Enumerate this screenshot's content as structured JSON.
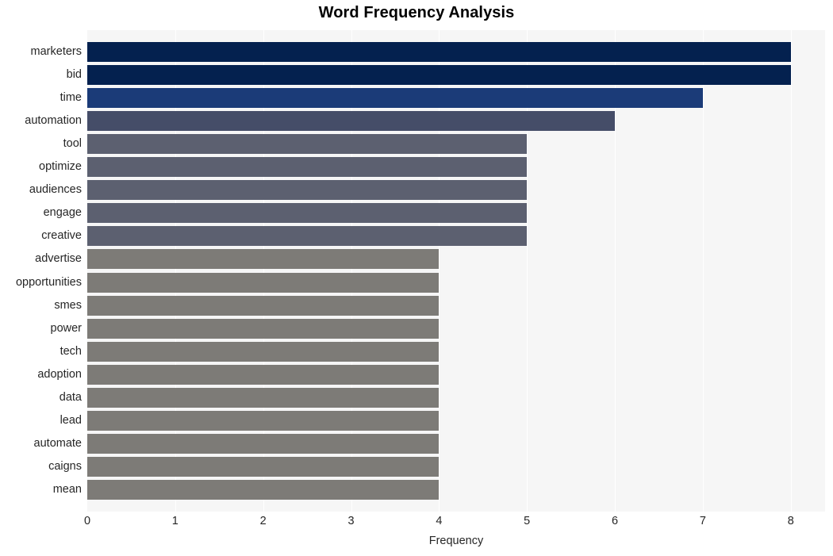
{
  "chart_data": {
    "type": "bar",
    "orientation": "horizontal",
    "title": "Word Frequency Analysis",
    "xlabel": "Frequency",
    "ylabel": "",
    "xlim": [
      0,
      8.39
    ],
    "xticks": [
      0,
      1,
      2,
      3,
      4,
      5,
      6,
      7,
      8
    ],
    "xtick_labels": [
      "0",
      "1",
      "2",
      "3",
      "4",
      "5",
      "6",
      "7",
      "8"
    ],
    "grid": true,
    "grid_axis": "x",
    "grid_color": "#ffffff",
    "plot_background": "#f6f6f6",
    "figure_background": "#ffffff",
    "legend": null,
    "categories": [
      "marketers",
      "bid",
      "time",
      "automation",
      "tool",
      "optimize",
      "audiences",
      "engage",
      "creative",
      "advertise",
      "opportunities",
      "smes",
      "power",
      "tech",
      "adoption",
      "data",
      "lead",
      "automate",
      "caigns",
      "mean"
    ],
    "values": [
      8,
      8,
      7,
      6,
      5,
      5,
      5,
      5,
      5,
      4,
      4,
      4,
      4,
      4,
      4,
      4,
      4,
      4,
      4,
      4
    ],
    "bar_colors": [
      "#04214f",
      "#04214f",
      "#1b3b78",
      "#454d68",
      "#5c6070",
      "#5c6070",
      "#5c6070",
      "#5c6070",
      "#5c6070",
      "#7d7b77",
      "#7d7b77",
      "#7d7b77",
      "#7d7b77",
      "#7d7b77",
      "#7d7b77",
      "#7d7b77",
      "#7d7b77",
      "#7d7b77",
      "#7d7b77",
      "#7d7b77"
    ]
  }
}
